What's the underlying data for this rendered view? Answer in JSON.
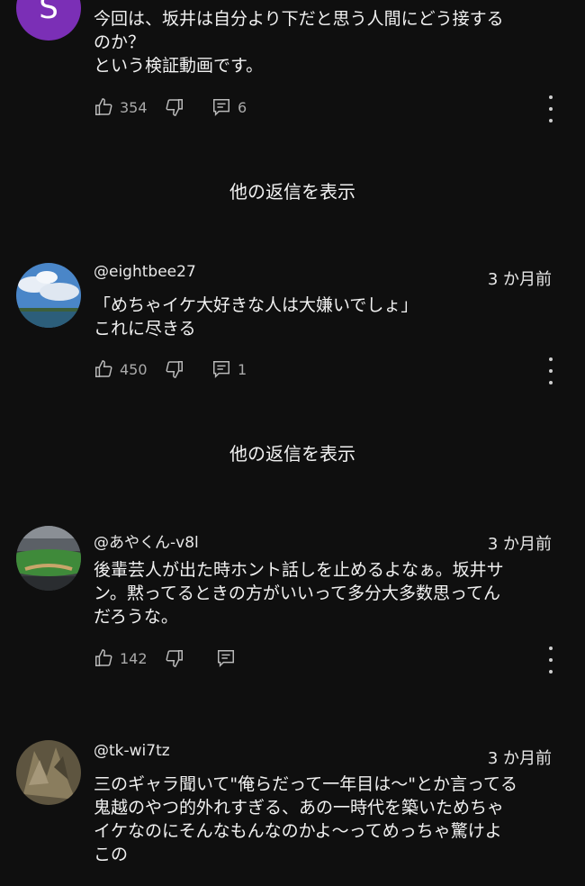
{
  "comments": [
    {
      "author": "",
      "avatar_letter": "S",
      "time": "",
      "text": "今回は、坂井は自分より下だと思う人間にどう接する\nのか？\nという検証動画です。",
      "likes": "354",
      "replies_count": "6",
      "show_replies": "他の返信を表示"
    },
    {
      "author": "@eightbee27",
      "time": "3 か月前",
      "text": "「めちゃイケ大好きな人は大嫌いでしょ」\nこれに尽きる",
      "likes": "450",
      "replies_count": "1",
      "show_replies": "他の返信を表示"
    },
    {
      "author": "@あやくん-v8l",
      "time": "3 か月前",
      "text": "後輩芸人が出た時ホント話しを止めるよなぁ。坂井サ\nン。黙ってるときの方がいいって多分大多数思ってん\nだろうな。",
      "likes": "142",
      "replies_count": ""
    },
    {
      "author": "@tk-wi7tz",
      "time": "3 か月前",
      "text": "三のギャラ聞いて\"俺らだって一年目は〜\"とか言ってる\n鬼越のやつ的外れすぎる、あの一時代を築いためちゃ\nイケなのにそんなもんなのかよ〜ってめっちゃ驚けよ\nこの"
    }
  ],
  "icons": {
    "like": "thumbs-up-icon",
    "dislike": "thumbs-down-icon",
    "reply": "reply-comment-icon",
    "more": "more-vertical-icon"
  },
  "colors": {
    "background": "#0f0f0f",
    "text": "#f1f1f1",
    "muted": "#aaaaaa",
    "avatar_purple": "#7b2fb6"
  }
}
